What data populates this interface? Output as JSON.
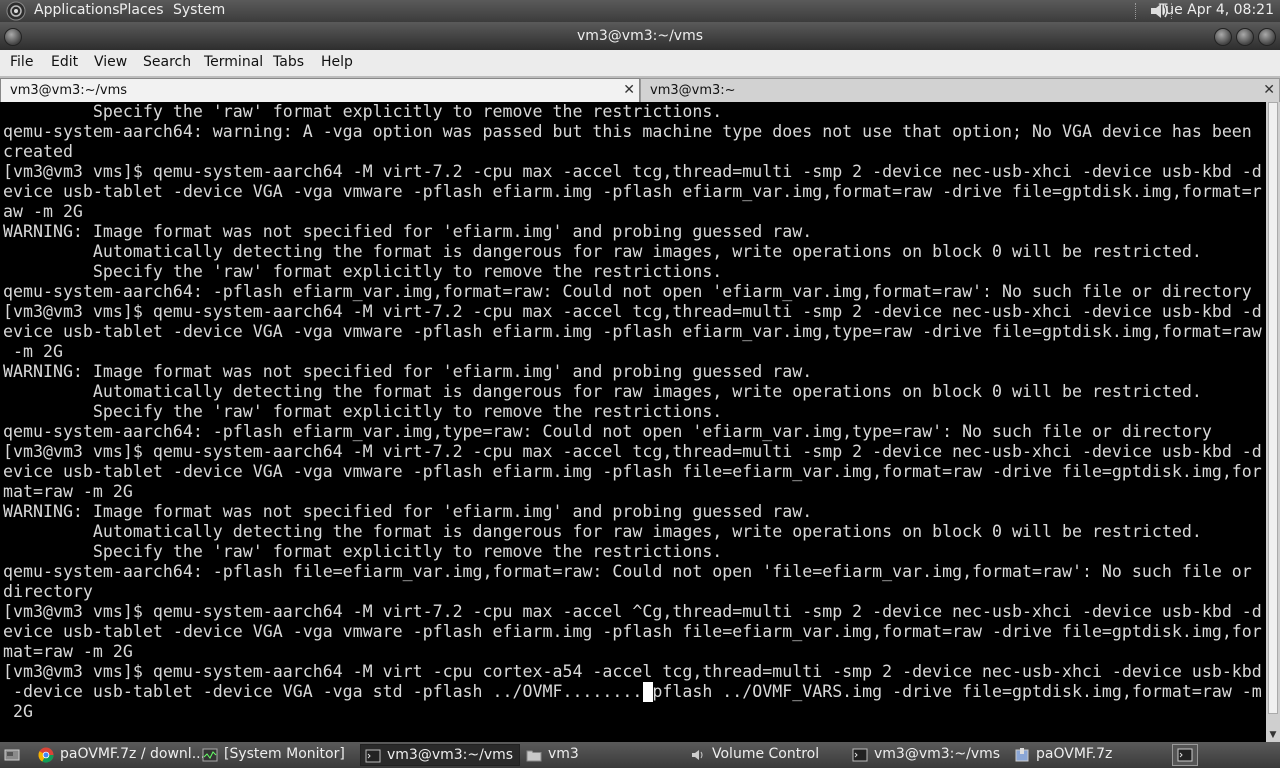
{
  "top_panel": {
    "menus": [
      "Applications",
      "Places",
      "System"
    ],
    "clock": "Tue Apr  4, 08:21",
    "icons": [
      "gnome-foot-icon",
      "speaker-icon"
    ]
  },
  "window": {
    "title": "vm3@vm3:~/vms"
  },
  "menubar": [
    "File",
    "Edit",
    "View",
    "Search",
    "Terminal",
    "Tabs",
    "Help"
  ],
  "tabs": [
    {
      "label": "vm3@vm3:~/vms",
      "close": "✕",
      "active": true
    },
    {
      "label": "vm3@vm3:~",
      "close": "✕",
      "active": false
    }
  ],
  "terminal": {
    "lines": [
      "         Specify the 'raw' format explicitly to remove the restrictions.",
      "qemu-system-aarch64: warning: A -vga option was passed but this machine type does not use that option; No VGA device has been",
      "created",
      "[vm3@vm3 vms]$ qemu-system-aarch64 -M virt-7.2 -cpu max -accel tcg,thread=multi -smp 2 -device nec-usb-xhci -device usb-kbd -d",
      "evice usb-tablet -device VGA -vga vmware -pflash efiarm.img -pflash efiarm_var.img,format=raw -drive file=gptdisk.img,format=r",
      "aw -m 2G",
      "WARNING: Image format was not specified for 'efiarm.img' and probing guessed raw.",
      "         Automatically detecting the format is dangerous for raw images, write operations on block 0 will be restricted.",
      "         Specify the 'raw' format explicitly to remove the restrictions.",
      "qemu-system-aarch64: -pflash efiarm_var.img,format=raw: Could not open 'efiarm_var.img,format=raw': No such file or directory",
      "[vm3@vm3 vms]$ qemu-system-aarch64 -M virt-7.2 -cpu max -accel tcg,thread=multi -smp 2 -device nec-usb-xhci -device usb-kbd -d",
      "evice usb-tablet -device VGA -vga vmware -pflash efiarm.img -pflash efiarm_var.img,type=raw -drive file=gptdisk.img,format=raw",
      " -m 2G",
      "WARNING: Image format was not specified for 'efiarm.img' and probing guessed raw.",
      "         Automatically detecting the format is dangerous for raw images, write operations on block 0 will be restricted.",
      "         Specify the 'raw' format explicitly to remove the restrictions.",
      "qemu-system-aarch64: -pflash efiarm_var.img,type=raw: Could not open 'efiarm_var.img,type=raw': No such file or directory",
      "[vm3@vm3 vms]$ qemu-system-aarch64 -M virt-7.2 -cpu max -accel tcg,thread=multi -smp 2 -device nec-usb-xhci -device usb-kbd -d",
      "evice usb-tablet -device VGA -vga vmware -pflash efiarm.img -pflash file=efiarm_var.img,format=raw -drive file=gptdisk.img,for",
      "mat=raw -m 2G",
      "WARNING: Image format was not specified for 'efiarm.img' and probing guessed raw.",
      "         Automatically detecting the format is dangerous for raw images, write operations on block 0 will be restricted.",
      "         Specify the 'raw' format explicitly to remove the restrictions.",
      "qemu-system-aarch64: -pflash file=efiarm_var.img,format=raw: Could not open 'file=efiarm_var.img,format=raw': No such file or",
      "directory",
      "[vm3@vm3 vms]$ qemu-system-aarch64 -M virt-7.2 -cpu max -accel ^Cg,thread=multi -smp 2 -device nec-usb-xhci -device usb-kbd -d",
      "evice usb-tablet -device VGA -vga vmware -pflash efiarm.img -pflash file=efiarm_var.img,format=raw -drive file=gptdisk.img,for",
      "mat=raw -m 2G",
      "[vm3@vm3 vms]$ qemu-system-aarch64 -M virt -cpu cortex-a54 -accel tcg,thread=multi -smp 2 -device nec-usb-xhci -device usb-kbd",
      " -device usb-tablet -device VGA -vga std -pflash ../OVMF........-pflash ../OVMF_VARS.img -drive file=gptdisk.img,format=raw -m",
      " 2G"
    ],
    "cursor_line": 29,
    "cursor_col": 64,
    "colors": {
      "background": "#000000",
      "foreground": "#d9d9d9"
    }
  },
  "taskbar": {
    "tasks": [
      {
        "label": "paOVMF.7z / downl...",
        "icon": "chrome-icon",
        "active": false
      },
      {
        "label": "[System Monitor]",
        "icon": "system-monitor-icon",
        "active": false
      },
      {
        "label": "vm3@vm3:~/vms",
        "icon": "terminal-icon",
        "active": true
      },
      {
        "label": "vm3",
        "icon": "folder-icon",
        "active": false
      },
      {
        "label": "Volume Control",
        "icon": "volume-icon",
        "active": false
      },
      {
        "label": "vm3@vm3:~/vms",
        "icon": "terminal-icon",
        "active": false
      },
      {
        "label": "paOVMF.7z",
        "icon": "archive-icon",
        "active": false
      }
    ]
  }
}
